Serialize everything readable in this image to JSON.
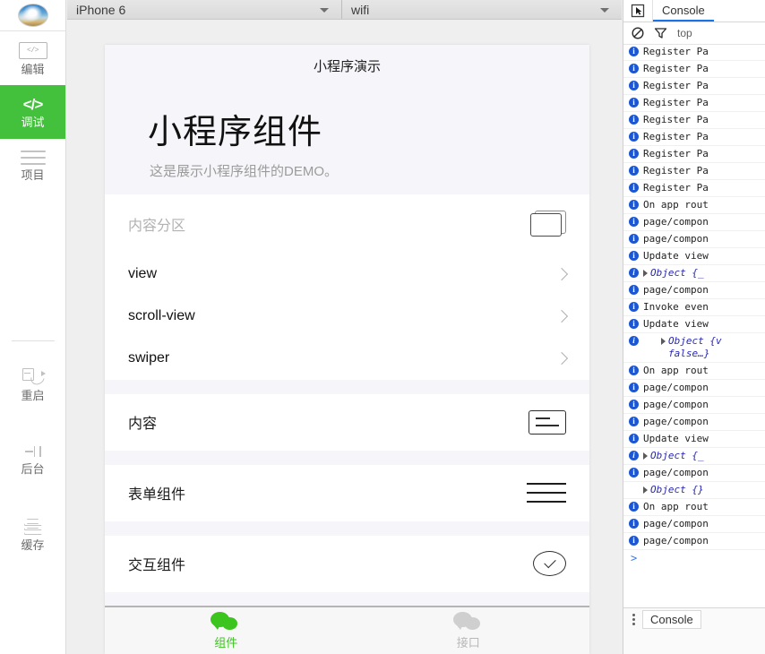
{
  "sidebar": {
    "avatar_name": "user-avatar",
    "items": [
      {
        "label": "编辑",
        "icon": "code-box-icon",
        "active": false
      },
      {
        "label": "调试",
        "icon": "code-icon",
        "active": true
      },
      {
        "label": "项目",
        "icon": "lines-icon",
        "active": false
      }
    ],
    "tools": [
      {
        "label": "重启",
        "icon": "restart-icon"
      },
      {
        "label": "后台",
        "icon": "background-icon"
      },
      {
        "label": "缓存",
        "icon": "layers-icon"
      }
    ]
  },
  "toolbar": {
    "device": "iPhone 6",
    "network": "wifi"
  },
  "simulator": {
    "nav_title": "小程序演示",
    "hero_title": "小程序组件",
    "hero_subtitle": "这是展示小程序组件的DEMO。",
    "sections": [
      {
        "head": "内容分区",
        "head_muted": true,
        "glyph": "cards-icon",
        "rows": [
          "view",
          "scroll-view",
          "swiper"
        ]
      },
      {
        "head": "内容",
        "head_muted": false,
        "glyph": "content-box-icon",
        "rows": []
      },
      {
        "head": "表单组件",
        "head_muted": false,
        "glyph": "menu-lines-icon",
        "rows": []
      },
      {
        "head": "交互组件",
        "head_muted": false,
        "glyph": "check-circle-icon",
        "rows": []
      }
    ],
    "tabbar": [
      {
        "label": "组件",
        "icon": "wechat-icon",
        "active": true
      },
      {
        "label": "接口",
        "icon": "wechat-icon",
        "active": false
      }
    ],
    "accent": "#3cc51f"
  },
  "devtools": {
    "inspect_icon": "inspect-cursor-icon",
    "tab": "Console",
    "clear_icon": "clear-console-icon",
    "filter_icon": "filter-icon",
    "context": "top",
    "prompt": ">",
    "drawer_tab": "Console",
    "logs": [
      {
        "icon": "info",
        "text": "Register Pa",
        "type": "plain"
      },
      {
        "icon": "info",
        "text": "Register Pa",
        "type": "plain"
      },
      {
        "icon": "info",
        "text": "Register Pa",
        "type": "plain"
      },
      {
        "icon": "info",
        "text": "Register Pa",
        "type": "plain"
      },
      {
        "icon": "info",
        "text": "Register Pa",
        "type": "plain"
      },
      {
        "icon": "info",
        "text": "Register Pa",
        "type": "plain"
      },
      {
        "icon": "info",
        "text": "Register Pa",
        "type": "plain"
      },
      {
        "icon": "info",
        "text": "Register Pa",
        "type": "plain"
      },
      {
        "icon": "info",
        "text": "Register Pa",
        "type": "plain"
      },
      {
        "icon": "info",
        "text": "On app rout",
        "type": "plain"
      },
      {
        "icon": "info",
        "text": "page/compon",
        "type": "plain"
      },
      {
        "icon": "info",
        "text": "page/compon",
        "type": "plain"
      },
      {
        "icon": "info",
        "text": "Update view",
        "type": "plain"
      },
      {
        "icon": "info",
        "text": "Object {_",
        "type": "object"
      },
      {
        "icon": "info",
        "text": "page/compon",
        "type": "plain"
      },
      {
        "icon": "info",
        "text": "Invoke even",
        "type": "plain"
      },
      {
        "icon": "info",
        "text": "Update view",
        "type": "plain"
      },
      {
        "icon": "info",
        "text": "Object {v",
        "text2": "false…}",
        "type": "object-indent"
      },
      {
        "icon": "info",
        "text": "On app rout",
        "type": "plain"
      },
      {
        "icon": "info",
        "text": "page/compon",
        "type": "plain"
      },
      {
        "icon": "info",
        "text": "page/compon",
        "type": "plain"
      },
      {
        "icon": "info",
        "text": "page/compon",
        "type": "plain"
      },
      {
        "icon": "info",
        "text": "Update view",
        "type": "plain"
      },
      {
        "icon": "info",
        "text": "Object {_",
        "type": "object"
      },
      {
        "icon": "info",
        "text": "page/compon",
        "type": "plain"
      },
      {
        "icon": "none",
        "text": "Object {}",
        "type": "object-noicon"
      },
      {
        "icon": "info",
        "text": "On app rout",
        "type": "plain"
      },
      {
        "icon": "info",
        "text": "page/compon",
        "type": "plain"
      },
      {
        "icon": "info",
        "text": "page/compon",
        "type": "plain"
      }
    ]
  }
}
